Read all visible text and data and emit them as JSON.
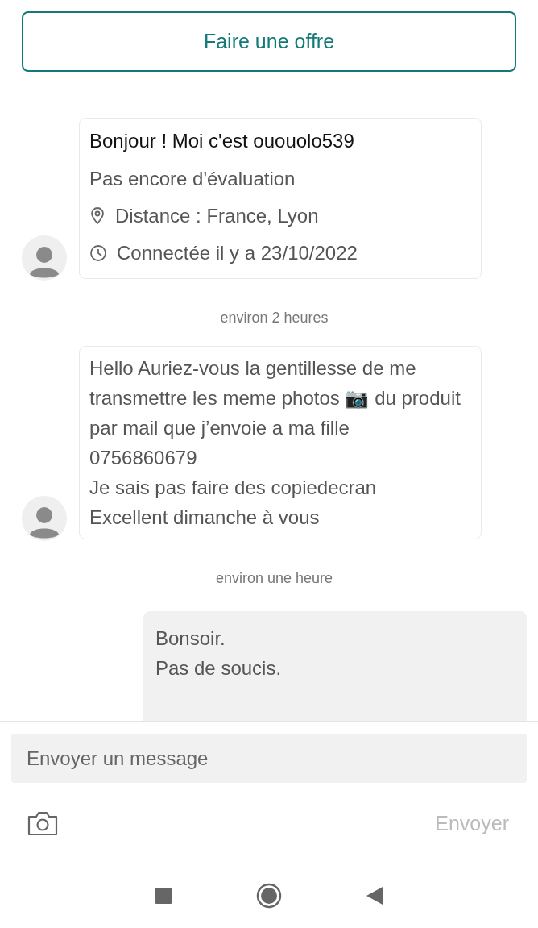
{
  "offer_button": {
    "label": "Faire une offre"
  },
  "messages": [
    {
      "kind": "profile",
      "outgoing": false,
      "title": "Bonjour ! Moi c'est ououolo539",
      "rating": "Pas encore d'évaluation",
      "location": "Distance : France, Lyon",
      "last_seen": "Connectée il y a 23/10/2022"
    },
    {
      "kind": "timestamp",
      "text": "environ 2 heures"
    },
    {
      "kind": "text",
      "outgoing": false,
      "lines": [
        "Hello Auriez-vous la gentillesse de me transmettre les meme photos 📷 du produit par mail que j’envoie a ma fille",
        "0756860679",
        "Je sais pas faire des copiedecran",
        "Excellent dimanche à vous"
      ]
    },
    {
      "kind": "timestamp",
      "text": "environ une heure"
    },
    {
      "kind": "text",
      "outgoing": true,
      "lines": [
        "Bonsoir.",
        "Pas de soucis."
      ]
    }
  ],
  "composer": {
    "placeholder": "Envoyer un message",
    "send_label": "Envoyer",
    "send_disabled": true
  }
}
